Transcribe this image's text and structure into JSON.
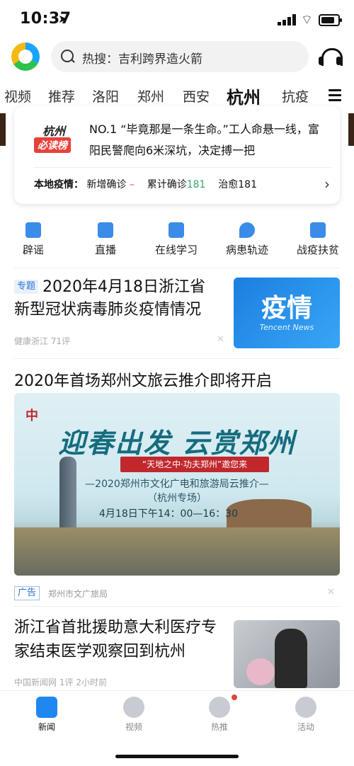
{
  "status_bar": {
    "time": "10:37"
  },
  "search": {
    "text": "热搜：吉利跨界造火箭"
  },
  "tabs": [
    "视频",
    "推荐",
    "洛阳",
    "郑州",
    "西安",
    "杭州",
    "抗疫"
  ],
  "active_tab": "杭州",
  "must_read": {
    "city": "杭州",
    "badge": "必读榜",
    "headline": "NO.1 “毕竟那是一条生命。”工人命悬一线，富阳民警爬向6米深坑，决定搏一把",
    "stats_label": "本地疫情：",
    "new_label": "新增确诊",
    "new_value": "–",
    "total_label": "累计确诊",
    "total_value": "181",
    "cured_label": "治愈",
    "cured_value": "181"
  },
  "quick_links": [
    {
      "label": "辟谣",
      "icon": "rumor-icon",
      "color": "#3b8be8"
    },
    {
      "label": "直播",
      "icon": "live-video-icon",
      "color": "#3b8be8"
    },
    {
      "label": "在线学习",
      "icon": "online-learning-icon",
      "color": "#3b8be8"
    },
    {
      "label": "病患轨迹",
      "icon": "location-pin-icon",
      "color": "#3b8be8"
    },
    {
      "label": "战疫扶贫",
      "icon": "poverty-aid-icon",
      "color": "#3b8be8"
    }
  ],
  "feed": {
    "news1": {
      "tag": "专题",
      "title": "2020年4月18日浙江省新型冠状病毒肺炎疫情情况",
      "source": "健康浙江",
      "comments": "71评",
      "thumb_big": "疫情",
      "thumb_small": "Tencent News"
    },
    "news2": {
      "title": "2020年首场郑州文旅云推介即将开启",
      "banner_title": "迎春出发 云赏郑州",
      "banner_ribbon": "“天地之中·功夫郑州”邀您来",
      "banner_sub": "—2020郑州市文化广电和旅游局云推介—",
      "banner_sub2": "（杭州专场）",
      "banner_time": "4月18日下午14：00—16：30",
      "ad_tag": "广告",
      "ad_source": "郑州市文广旅局"
    },
    "news3": {
      "title": "浙江省首批援助意大利医疗专家结束医学观察回到杭州",
      "source": "中国新闻网",
      "comments": "1评",
      "time": "2小时前"
    }
  },
  "bottom_nav": [
    {
      "label": "新闻",
      "icon": "news-icon"
    },
    {
      "label": "视频",
      "icon": "video-play-icon"
    },
    {
      "label": "热推",
      "icon": "hot-push-icon"
    },
    {
      "label": "活动",
      "icon": "activity-icon"
    }
  ],
  "colors": {
    "accent": "#1e87f0",
    "red": "#e0453a",
    "green": "#3aa66b"
  }
}
